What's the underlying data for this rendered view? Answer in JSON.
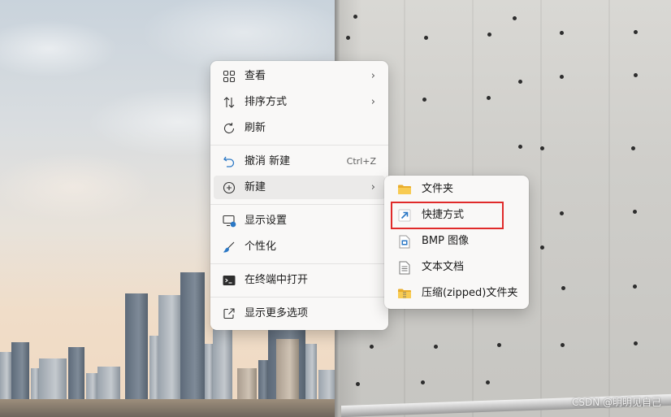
{
  "context_menu": {
    "items": [
      {
        "label": "查看",
        "icon": "grid-view-icon",
        "submenu": true
      },
      {
        "label": "排序方式",
        "icon": "sort-arrows-icon",
        "submenu": true
      },
      {
        "label": "刷新",
        "icon": "refresh-icon"
      },
      {
        "label": "撤消 新建",
        "icon": "undo-icon",
        "shortcut": "Ctrl+Z"
      },
      {
        "label": "新建",
        "icon": "plus-circle-icon",
        "submenu": true
      },
      {
        "label": "显示设置",
        "icon": "display-settings-icon"
      },
      {
        "label": "个性化",
        "icon": "brush-icon"
      },
      {
        "label": "在终端中打开",
        "icon": "terminal-icon"
      },
      {
        "label": "显示更多选项",
        "icon": "share-more-icon"
      }
    ]
  },
  "new_submenu": {
    "items": [
      {
        "label": "文件夹",
        "icon": "folder-icon"
      },
      {
        "label": "快捷方式",
        "icon": "shortcut-icon"
      },
      {
        "label": "BMP 图像",
        "icon": "bmp-image-icon"
      },
      {
        "label": "文本文档",
        "icon": "text-document-icon"
      },
      {
        "label": "压缩(zipped)文件夹",
        "icon": "zip-folder-icon"
      }
    ]
  },
  "watermark": "CSDN @明明见自己",
  "colors": {
    "menu_bg": "#f9f8f7",
    "hover_bg": "#ebeae9",
    "highlight_border": "#e02a2a",
    "icon_blue": "#2b78c5",
    "folder_yellow": "#f5c342"
  }
}
